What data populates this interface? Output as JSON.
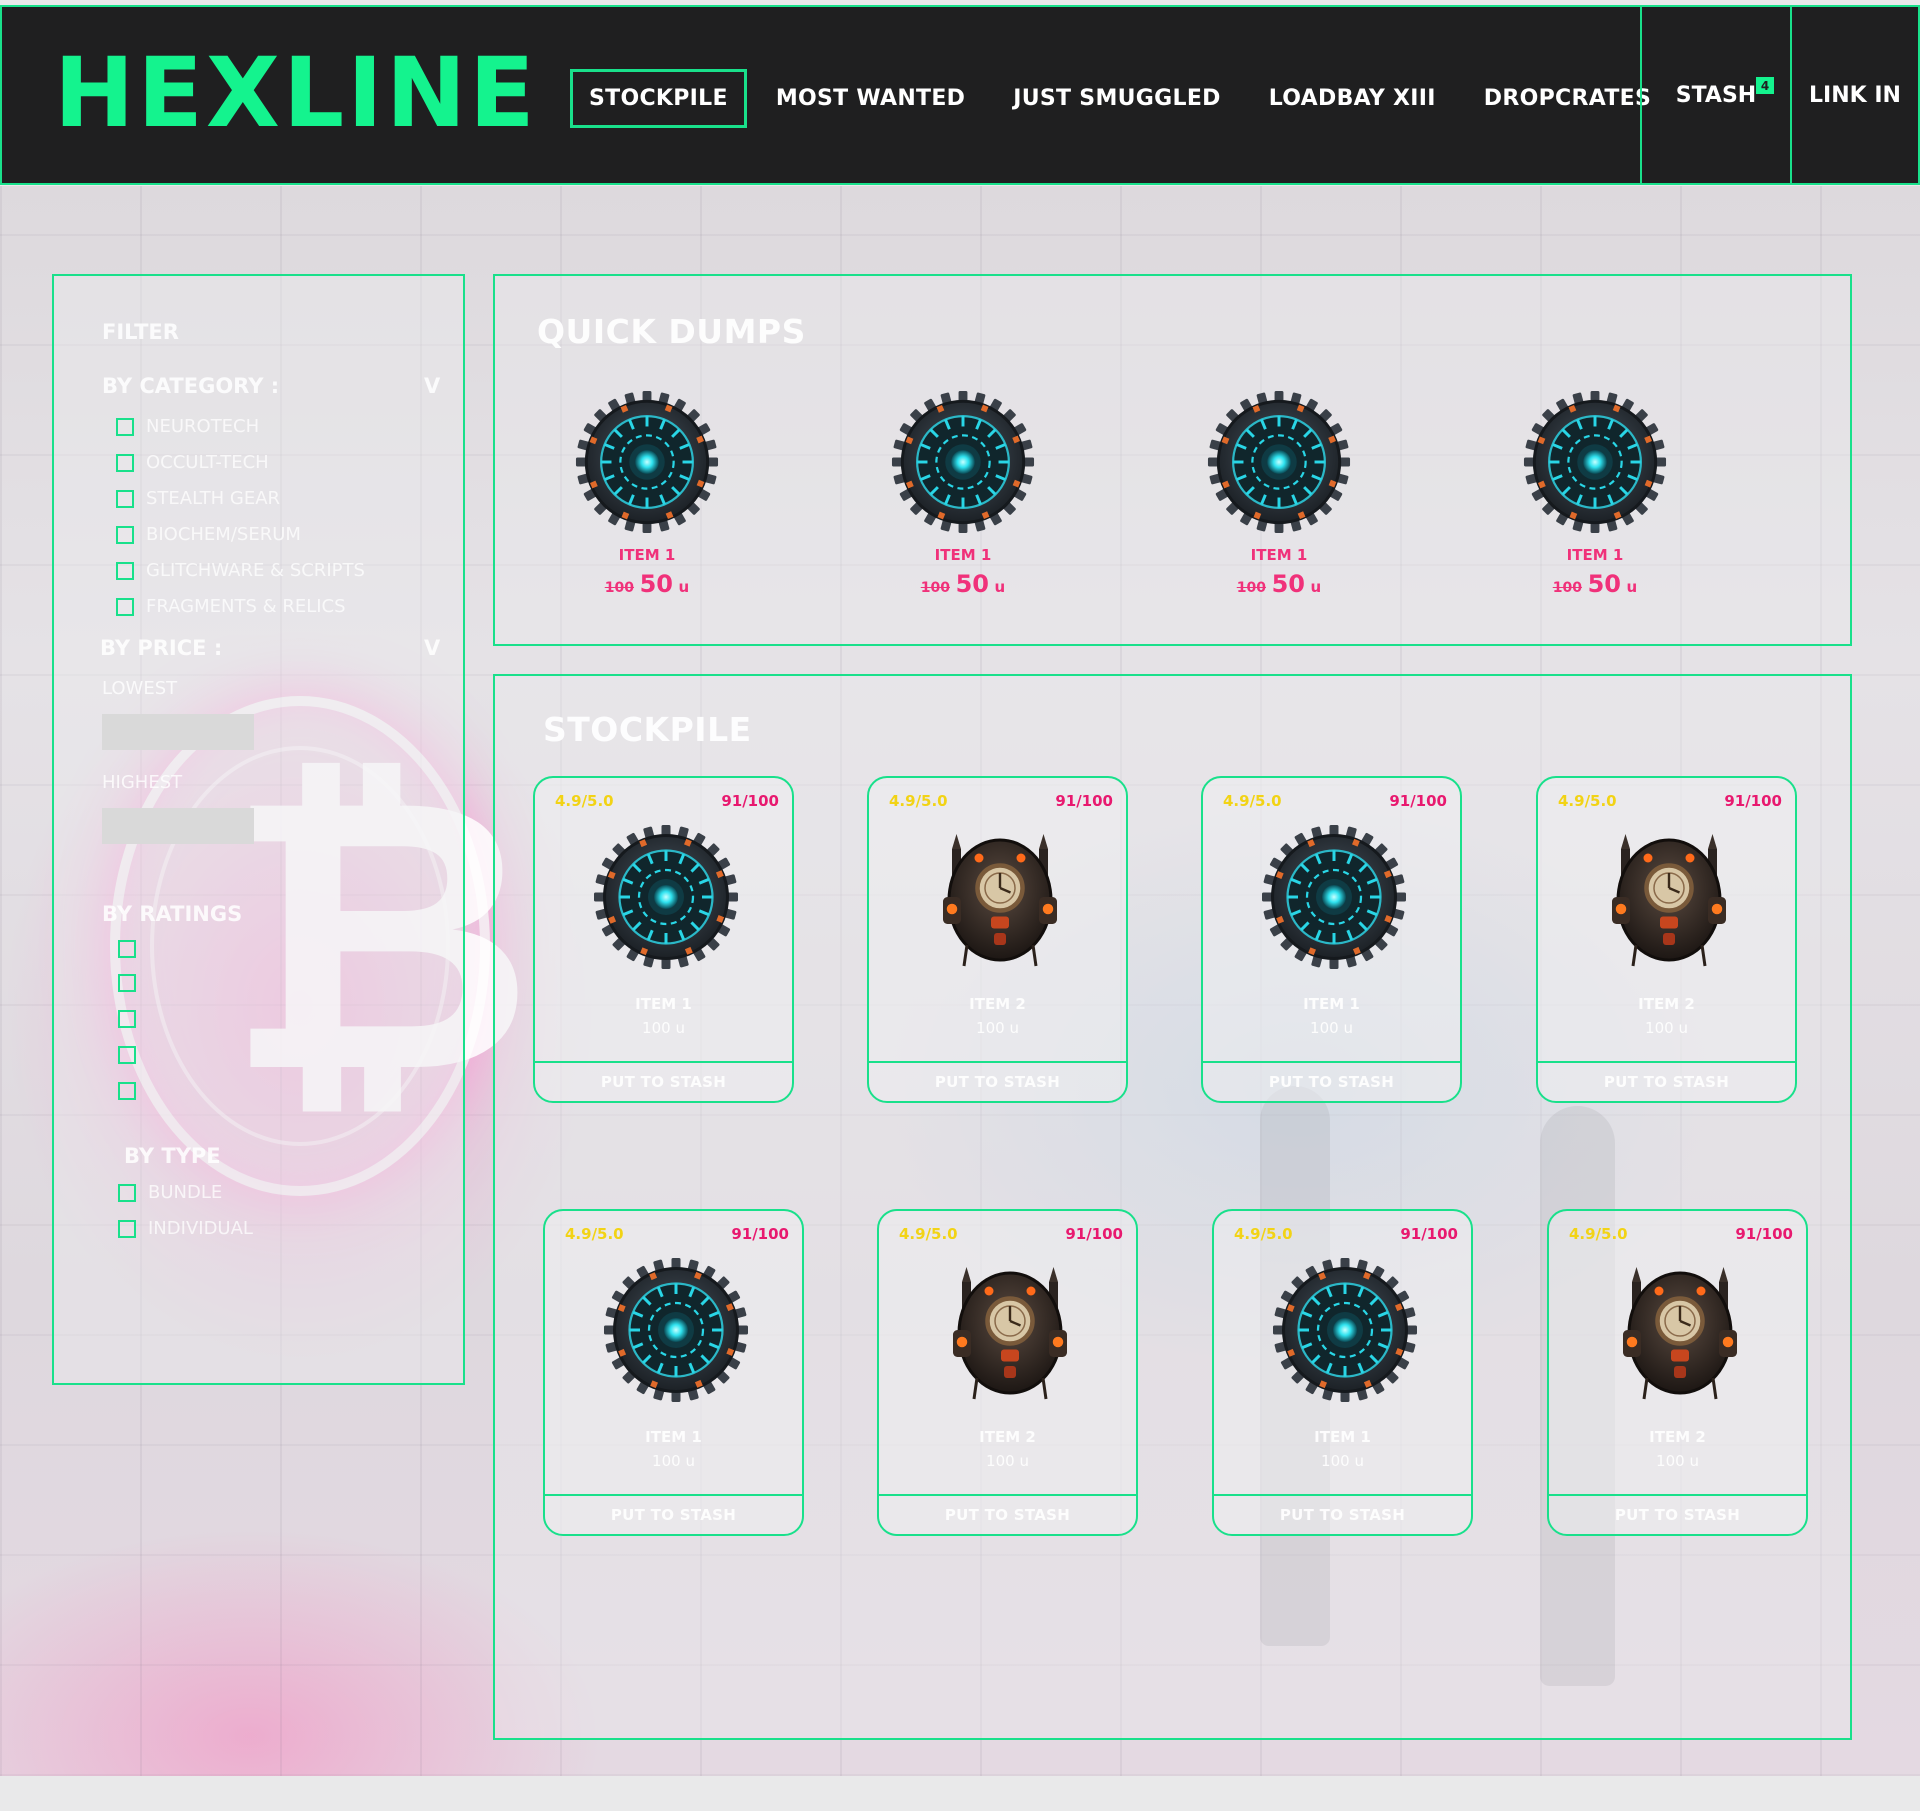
{
  "brand": "HEXLINE",
  "nav": {
    "items": [
      "STOCKPILE",
      "MOST WANTED",
      "JUST SMUGGLED",
      "LOADBAY XIII",
      "DROPCRATES"
    ],
    "active_index": 0,
    "stash_label": "STASH",
    "stash_count": "4",
    "login_label": "LINK IN"
  },
  "filter": {
    "title": "FILTER",
    "category_label": "BY CATEGORY :",
    "category_caret": "V",
    "categories": [
      "NEUROTECH",
      "OCCULT-TECH",
      "STEALTH GEAR",
      "BIOCHEM/SERUM",
      "GLITCHWARE & SCRIPTS",
      "FRAGMENTS & RELICS"
    ],
    "price_label": "BY PRICE :",
    "price_caret": "V",
    "lowest_label": "LOWEST",
    "highest_label": "HIGHEST",
    "ratings_label": "BY RATINGS",
    "rating_options_count": 5,
    "type_label": "BY TYPE",
    "types": [
      "BUNDLE",
      "INDIVIDUAL"
    ]
  },
  "quick_dumps": {
    "title": "QUICK DUMPS",
    "items": [
      {
        "name": "ITEM 1",
        "old_price": "100",
        "new_price": "50",
        "unit": "u",
        "icon": "cyber-orb"
      },
      {
        "name": "ITEM 1",
        "old_price": "100",
        "new_price": "50",
        "unit": "u",
        "icon": "cyber-orb"
      },
      {
        "name": "ITEM 1",
        "old_price": "100",
        "new_price": "50",
        "unit": "u",
        "icon": "cyber-orb"
      },
      {
        "name": "ITEM 1",
        "old_price": "100",
        "new_price": "50",
        "unit": "u",
        "icon": "cyber-orb"
      }
    ]
  },
  "stockpile": {
    "title": "STOCKPILE",
    "button_label": "PUT TO STASH",
    "cards": [
      {
        "rating": "4.9/5.0",
        "score": "91/100",
        "name": "ITEM 1",
        "price": "100 u",
        "icon": "cyber-orb"
      },
      {
        "rating": "4.9/5.0",
        "score": "91/100",
        "name": "ITEM 2",
        "price": "100 u",
        "icon": "steampunk-pod"
      },
      {
        "rating": "4.9/5.0",
        "score": "91/100",
        "name": "ITEM 1",
        "price": "100 u",
        "icon": "cyber-orb"
      },
      {
        "rating": "4.9/5.0",
        "score": "91/100",
        "name": "ITEM 2",
        "price": "100 u",
        "icon": "steampunk-pod"
      },
      {
        "rating": "4.9/5.0",
        "score": "91/100",
        "name": "ITEM 1",
        "price": "100 u",
        "icon": "cyber-orb"
      },
      {
        "rating": "4.9/5.0",
        "score": "91/100",
        "name": "ITEM 2",
        "price": "100 u",
        "icon": "steampunk-pod"
      },
      {
        "rating": "4.9/5.0",
        "score": "91/100",
        "name": "ITEM 1",
        "price": "100 u",
        "icon": "cyber-orb"
      },
      {
        "rating": "4.9/5.0",
        "score": "91/100",
        "name": "ITEM 2",
        "price": "100 u",
        "icon": "steampunk-pod"
      }
    ]
  },
  "colors": {
    "accent": "#19e08b",
    "brand": "#14f38e",
    "header_bg": "#1f1f20",
    "price": "#f0317a",
    "rating": "#f2d315"
  }
}
